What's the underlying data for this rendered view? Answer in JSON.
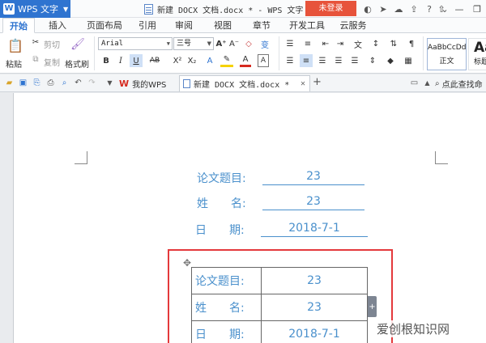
{
  "app": {
    "menu_label": "WPS 文字",
    "title": "新建 DOCX 文档.docx * - WPS 文字",
    "login_label": "未登录"
  },
  "tabs": [
    "开始",
    "插入",
    "页面布局",
    "引用",
    "审阅",
    "视图",
    "章节",
    "开发工具",
    "云服务"
  ],
  "ribbon": {
    "paste": "粘贴",
    "cut": "剪切",
    "copy": "复制",
    "format_painter": "格式刷",
    "font_name": "Arial",
    "font_size": "三号",
    "style_normal_sample": "AaBbCcDd",
    "style_normal_name": "正文",
    "style_heading_sample": "Aa",
    "style_heading_name": "标题"
  },
  "doc_tabs": [
    {
      "label": "我的WPS"
    },
    {
      "label": "新建 DOCX 文档.docx *"
    }
  ],
  "find_label": "点此查找命",
  "document": {
    "fields": [
      {
        "label": "论文题目:",
        "value": "23"
      },
      {
        "label": "姓　　名:",
        "value": "23"
      },
      {
        "label": "日　　期:",
        "value": "2018-7-1"
      }
    ],
    "table_rows": [
      {
        "label": "论文题目:",
        "value": "23"
      },
      {
        "label": "姓　　名:",
        "value": "23"
      },
      {
        "label": "日　　期:",
        "value": "2018-7-1"
      }
    ]
  },
  "watermark": "爱创根知识网",
  "colors": {
    "accent": "#2f74d0",
    "login": "#e7533b",
    "field_text": "#4a90cc",
    "highlight_box": "#e4393c"
  }
}
